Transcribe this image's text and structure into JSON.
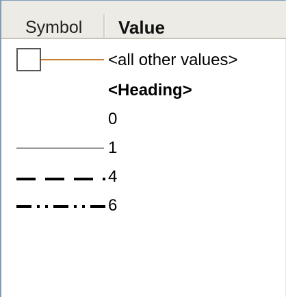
{
  "header": {
    "symbol_label": "Symbol",
    "value_label": "Value"
  },
  "rows": [
    {
      "label": "<all other values>",
      "symbol": "box-with-line",
      "line_color": "#c87a2a",
      "bold": false
    },
    {
      "label": "<Heading>",
      "symbol": "none",
      "bold": true
    },
    {
      "label": "0",
      "symbol": "none",
      "bold": false
    },
    {
      "label": "1",
      "symbol": "thin-solid-line",
      "line_color": "#9a9a9a",
      "bold": false
    },
    {
      "label": "4",
      "symbol": "thick-dashed-line",
      "line_color": "#000000",
      "bold": false
    },
    {
      "label": "6",
      "symbol": "dash-dot-dot-line",
      "line_color": "#000000",
      "bold": false
    }
  ],
  "colors": {
    "header_bg": "#ecebe5",
    "border": "#7f9db9"
  }
}
